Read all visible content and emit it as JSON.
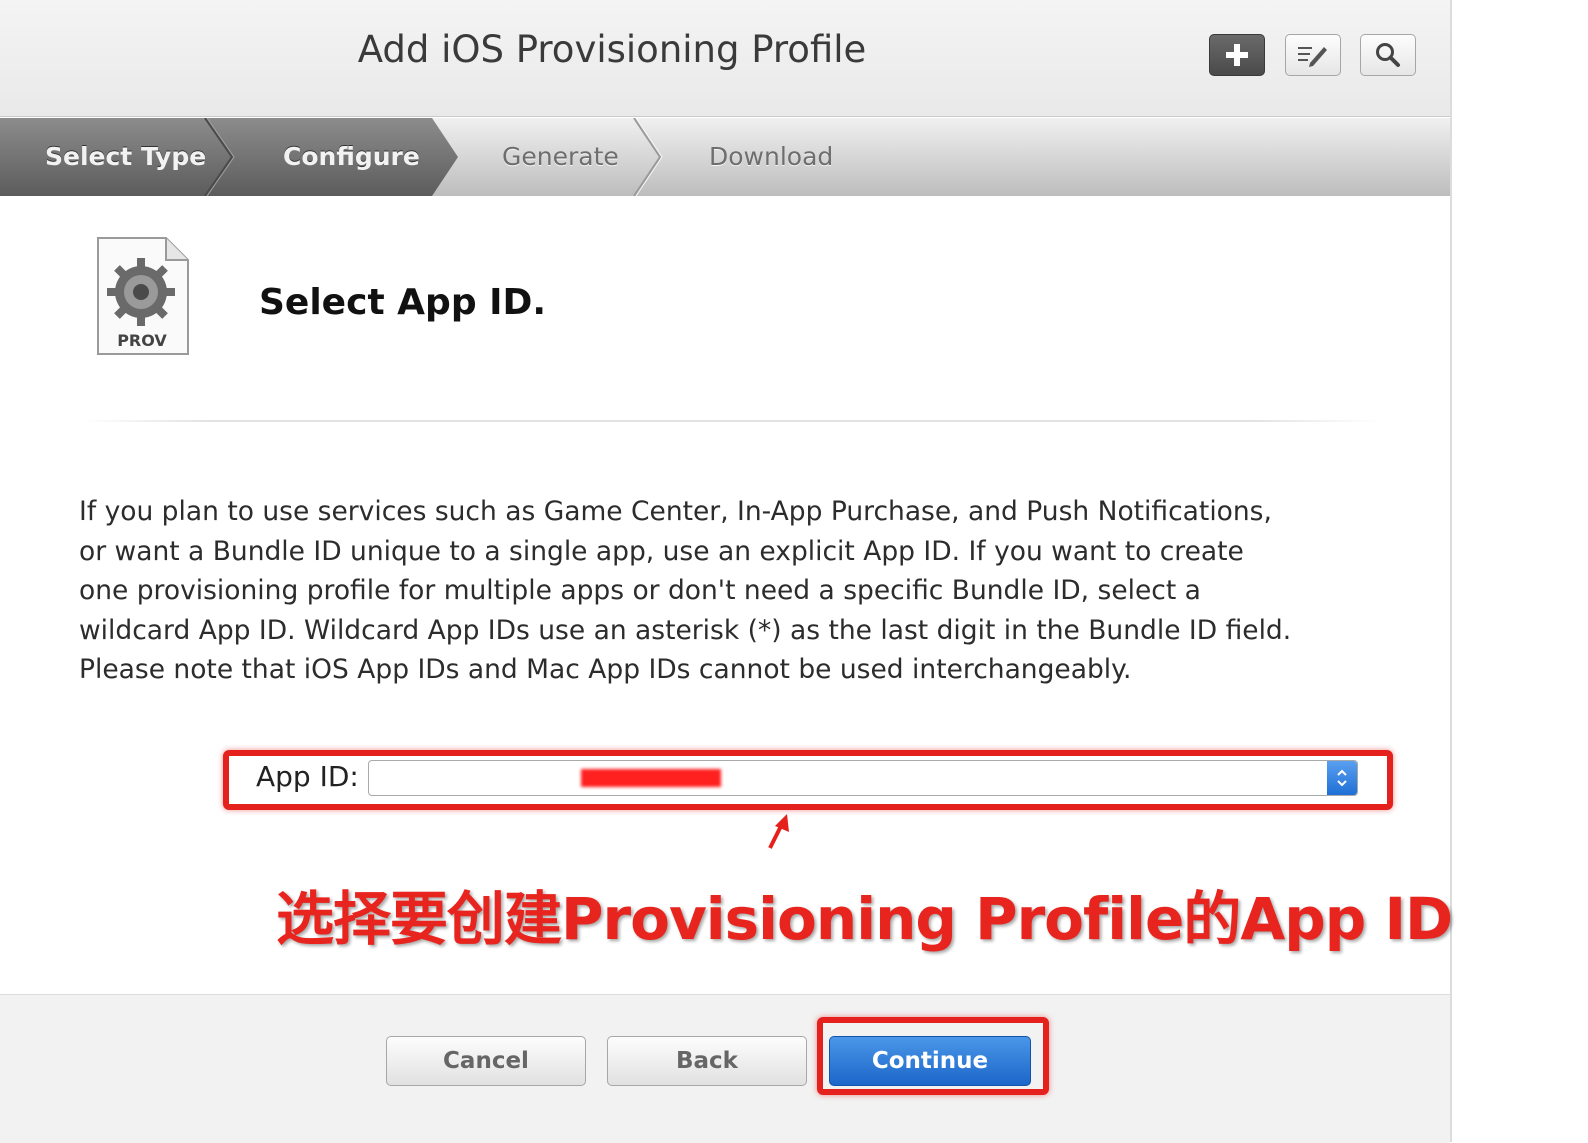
{
  "header": {
    "title": "Add iOS Provisioning Profile",
    "toolbar": [
      {
        "name": "add",
        "icon": "plus-icon"
      },
      {
        "name": "edit",
        "icon": "edit-icon"
      },
      {
        "name": "search",
        "icon": "search-icon"
      }
    ]
  },
  "steps": [
    {
      "label": "Select Type",
      "state": "done"
    },
    {
      "label": "Configure",
      "state": "current"
    },
    {
      "label": "Generate",
      "state": "pending"
    },
    {
      "label": "Download",
      "state": "pending"
    }
  ],
  "content": {
    "icon_label": "PROV",
    "section_title": "Select App ID.",
    "description": "If you plan to use services such as Game Center, In-App Purchase, and Push Notifications, or want a Bundle ID unique to a single app, use an explicit App ID. If you want to create one provisioning profile for multiple apps or don't need a specific Bundle ID, select a wildcard App ID. Wildcard App IDs use an asterisk (*) as the last digit in the Bundle ID field. Please note that iOS App IDs and Mac App IDs cannot be used interchangeably.",
    "app_id_label": "App ID:",
    "app_id_value": ""
  },
  "annotation": {
    "text": "选择要创建Provisioning Profile的App ID",
    "color": "#e8241e"
  },
  "footer": {
    "cancel_label": "Cancel",
    "back_label": "Back",
    "continue_label": "Continue"
  },
  "colors": {
    "accent": "#1c67c9",
    "annotation_red": "#e5211d"
  }
}
